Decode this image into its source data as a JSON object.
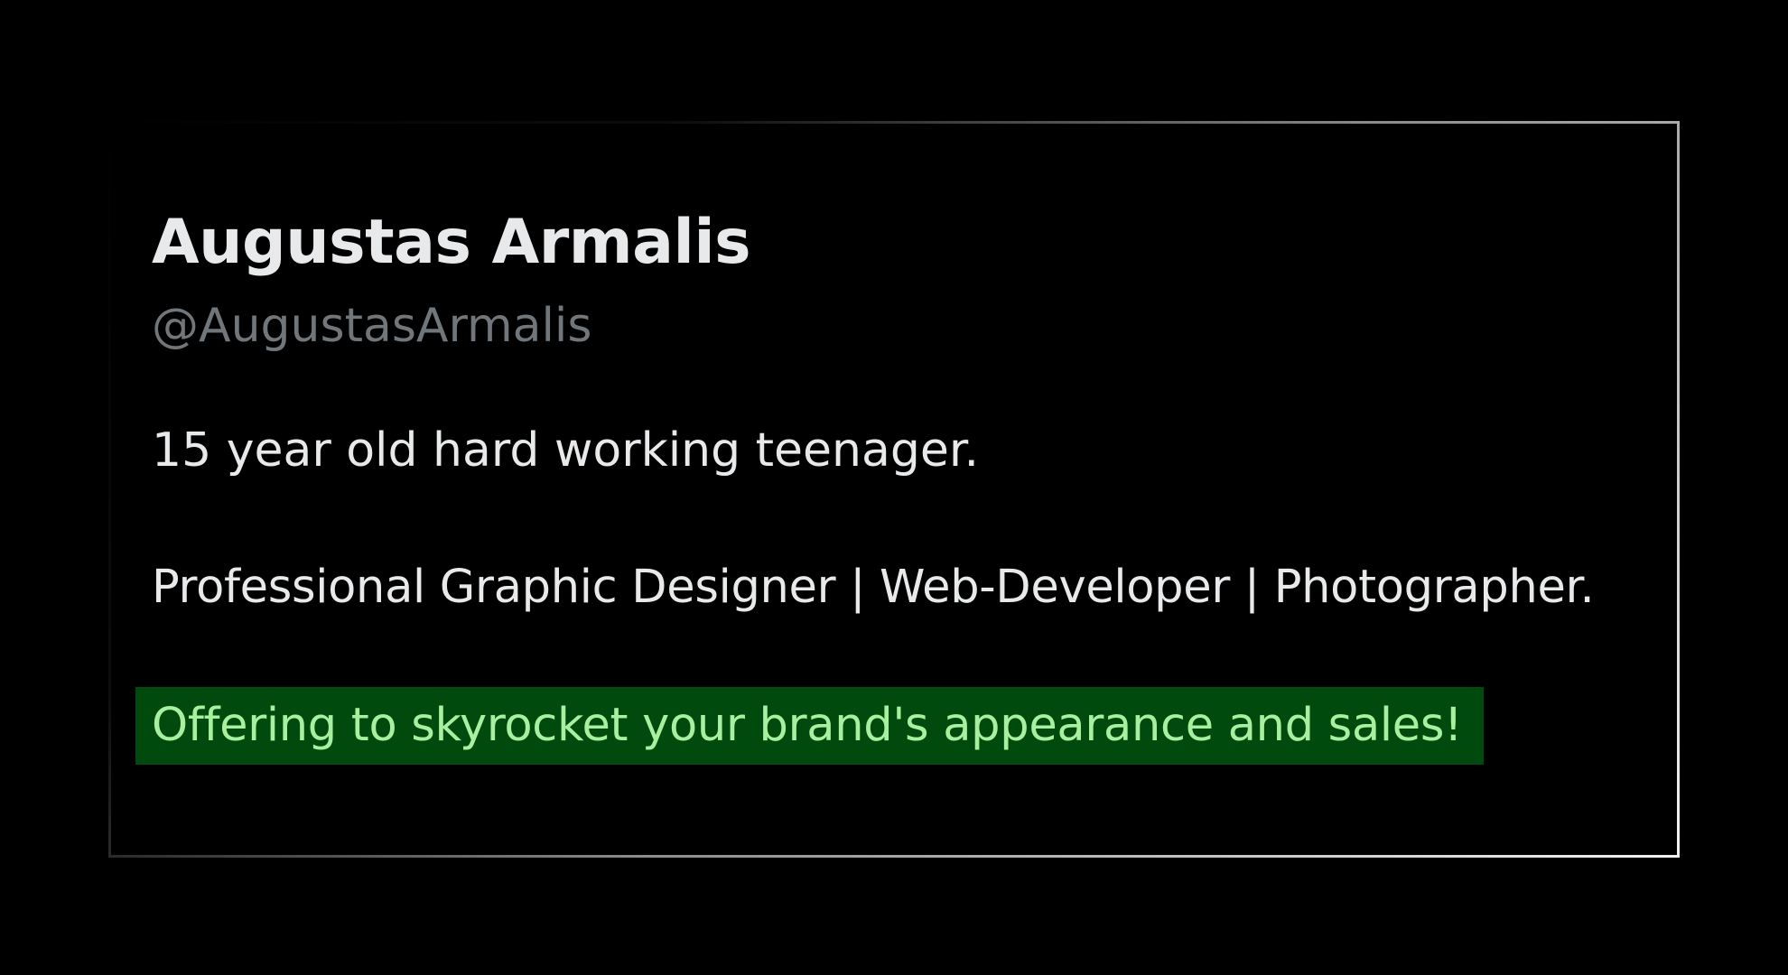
{
  "profile": {
    "display_name": "Augustas Armalis",
    "handle": "@AugustasArmalis",
    "bio": {
      "line1": "15 year old hard working teenager.",
      "line2": "Professional Graphic Designer | Web-Developer | Photographer.",
      "highlighted_line": "Offering to skyrocket your brand's appearance and sales!"
    }
  },
  "colors": {
    "background": "#000000",
    "primary_text": "#e7e9ea",
    "secondary_text": "#71767b",
    "highlight_background": "#004a0e",
    "highlight_text": "#a8f0a0"
  }
}
